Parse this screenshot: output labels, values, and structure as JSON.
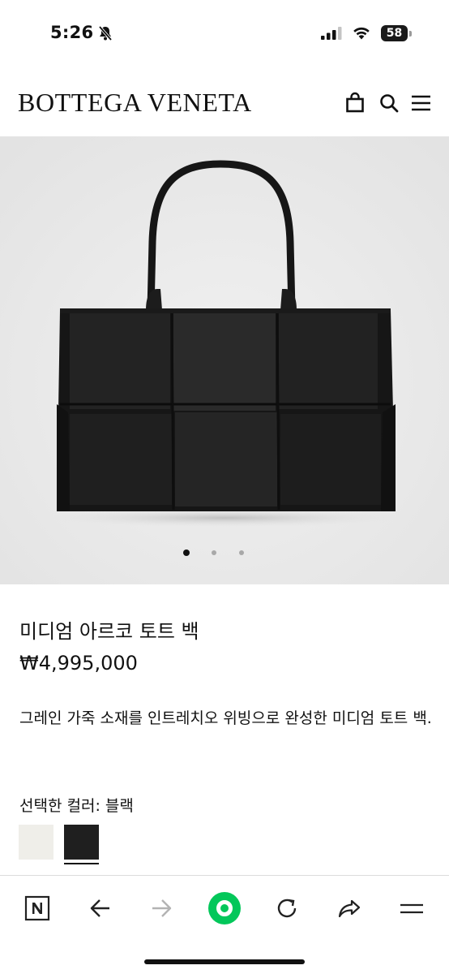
{
  "status_bar": {
    "time": "5:26",
    "battery": "58"
  },
  "header": {
    "logo": "BOTTEGA VENETA"
  },
  "icons": {
    "bell": "bell-slash-icon",
    "signal": "cellular-signal-icon",
    "wifi": "wifi-icon",
    "bag": "shopping-bag-icon",
    "search": "search-icon",
    "menu": "hamburger-menu-icon"
  },
  "hero": {
    "image": "black woven leather tote bag",
    "slide_count": 3,
    "active_slide": 1
  },
  "product": {
    "name": "미디엄 아르코 토트 백",
    "price": "₩4,995,000",
    "description": "그레인 가죽 소재를 인트레치오 위빙으로 완성한 미디엄 토트 백.",
    "color_label": "선택한 컬러: 블랙",
    "colors": [
      {
        "name": "white",
        "hex": "#efeee9",
        "selected": false
      },
      {
        "name": "black",
        "hex": "#1f1f1f",
        "selected": true
      }
    ]
  },
  "toolbar": {
    "buttons": [
      "naver-n-icon",
      "back-arrow-icon",
      "forward-arrow-icon",
      "green-home-icon",
      "reload-icon",
      "share-icon",
      "menu-icon"
    ],
    "accent": "#03c75a"
  }
}
